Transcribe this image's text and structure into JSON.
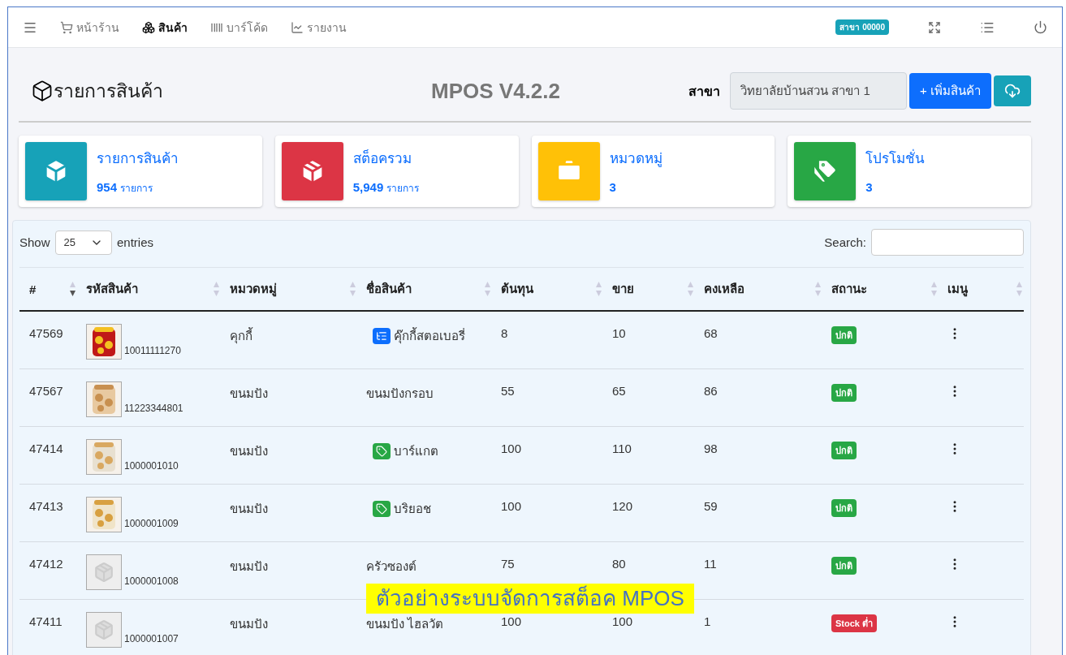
{
  "navbar": {
    "items": [
      {
        "label": "หน้าร้าน",
        "selected": false
      },
      {
        "label": "สินค้า",
        "selected": true
      },
      {
        "label": "บาร์โค้ด",
        "selected": false
      },
      {
        "label": "รายงาน",
        "selected": false
      }
    ],
    "branch_badge": "สาขา 00000"
  },
  "header": {
    "title": "รายการสินค้า",
    "version": "MPOS V4.2.2",
    "branch_label": "สาขา",
    "branch_value": "วิทยาลัยบ้านสวน สาขา 1",
    "add_button": "+ เพิ่มสินค้า"
  },
  "stats": [
    {
      "label": "รายการสินค้า",
      "value": "954",
      "unit": "รายการ",
      "color": "#17a2b8"
    },
    {
      "label": "สต็อครวม",
      "value": "5,949",
      "unit": "รายการ",
      "color": "#dc3545"
    },
    {
      "label": "หมวดหมู่",
      "value": "3",
      "color": "#ffc107"
    },
    {
      "label": "โปรโมชั่น",
      "value": "3",
      "color": "#28a745"
    }
  ],
  "table": {
    "show_label": "Show",
    "page_size": "25",
    "entries_label": "entries",
    "search_label": "Search:",
    "columns": [
      {
        "label": "#",
        "sorted": true
      },
      {
        "label": "รหัสสินค้า",
        "sorted": false
      },
      {
        "label": "หมวดหมู่",
        "sorted": false
      },
      {
        "label": "ชื่อสินค้า",
        "sorted": false
      },
      {
        "label": "ต้นทุน",
        "sorted": false
      },
      {
        "label": "ขาย",
        "sorted": false
      },
      {
        "label": "คงเหลือ",
        "sorted": false
      },
      {
        "label": "สถานะ",
        "sorted": false
      },
      {
        "label": "เมนู",
        "sorted": false
      }
    ],
    "rows": [
      {
        "id": "47569",
        "code": "10011111270",
        "category": "คุกกี้",
        "name_badge": {
          "kind": "list"
        },
        "name": "คุ๊กกี้สตอเบอรี่",
        "cost": "8",
        "price": "10",
        "remaining": "68",
        "status": {
          "label": "ปกติ",
          "kind": "normal"
        }
      },
      {
        "id": "47567",
        "code": "11223344801",
        "category": "ขนมปัง",
        "name": "ขนมปังกรอบ",
        "cost": "55",
        "price": "65",
        "remaining": "86",
        "status": {
          "label": "ปกติ",
          "kind": "normal"
        }
      },
      {
        "id": "47414",
        "code": "1000001010",
        "category": "ขนมปัง",
        "name_badge": {
          "kind": "tag"
        },
        "name": "บาร์แกต",
        "cost": "100",
        "price": "110",
        "remaining": "98",
        "status": {
          "label": "ปกติ",
          "kind": "normal"
        }
      },
      {
        "id": "47413",
        "code": "1000001009",
        "category": "ขนมปัง",
        "name_badge": {
          "kind": "tag"
        },
        "name": "บริยอช",
        "cost": "100",
        "price": "120",
        "remaining": "59",
        "status": {
          "label": "ปกติ",
          "kind": "normal"
        }
      },
      {
        "id": "47412",
        "thumb": {
          "kind": "placeholder"
        },
        "code": "1000001008",
        "category": "ขนมปัง",
        "name": "ครัวซองต์",
        "cost": "75",
        "price": "80",
        "remaining": "11",
        "status": {
          "label": "ปกติ",
          "kind": "normal"
        }
      },
      {
        "id": "47411",
        "thumb": {
          "kind": "placeholder"
        },
        "code": "1000001007",
        "category": "ขนมปัง",
        "name": "ขนมปัง ไฮลวัต",
        "cost": "100",
        "price": "100",
        "remaining": "1",
        "status": {
          "label": "Stock ต่ำ",
          "kind": "low"
        }
      }
    ]
  },
  "caption": "ตัวอย่างระบบจัดการสต็อค MPOS"
}
